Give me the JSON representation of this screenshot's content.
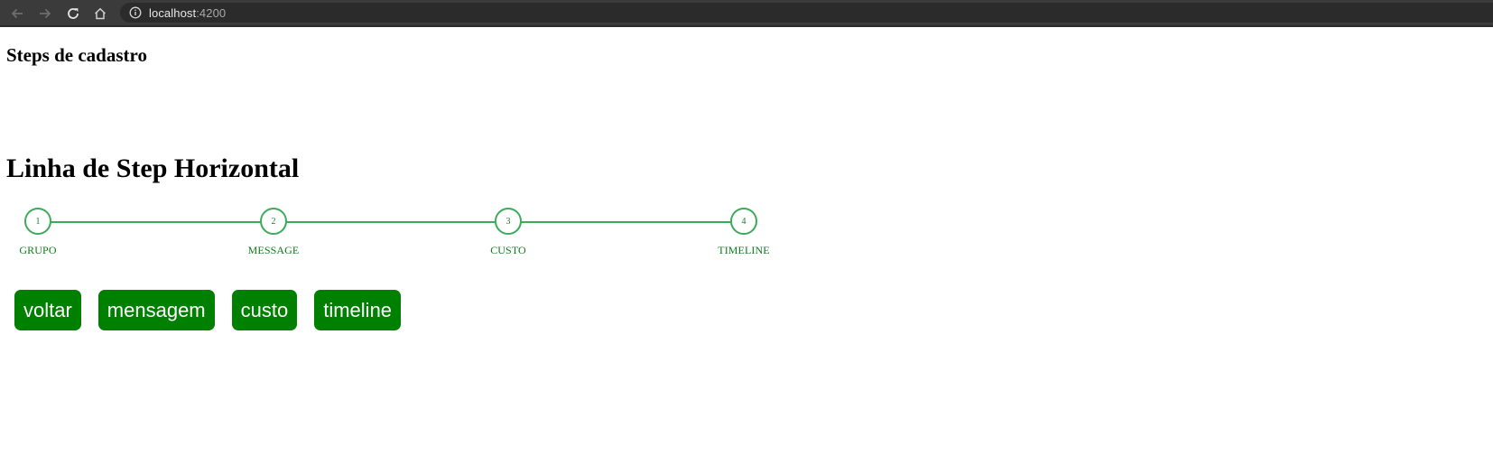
{
  "browser": {
    "url_host": "localhost",
    "url_port": ":4200",
    "icons": {
      "back": "arrow-left-icon",
      "forward": "arrow-right-icon",
      "reload": "reload-icon",
      "home": "home-icon",
      "site_info": "info-icon"
    }
  },
  "page": {
    "title_small": "Steps de cadastro",
    "title_big": "Linha de Step Horizontal"
  },
  "stepper": {
    "accent_color": "#3cab5a",
    "label_color": "#0d7a1f",
    "steps": [
      {
        "number": "1",
        "label": "GRUPO"
      },
      {
        "number": "2",
        "label": "MESSAGE"
      },
      {
        "number": "3",
        "label": "CUSTO"
      },
      {
        "number": "4",
        "label": "TIMELINE"
      }
    ]
  },
  "buttons": {
    "color": "#008000",
    "items": [
      {
        "label": "voltar"
      },
      {
        "label": "mensagem"
      },
      {
        "label": "custo"
      },
      {
        "label": "timeline"
      }
    ]
  }
}
